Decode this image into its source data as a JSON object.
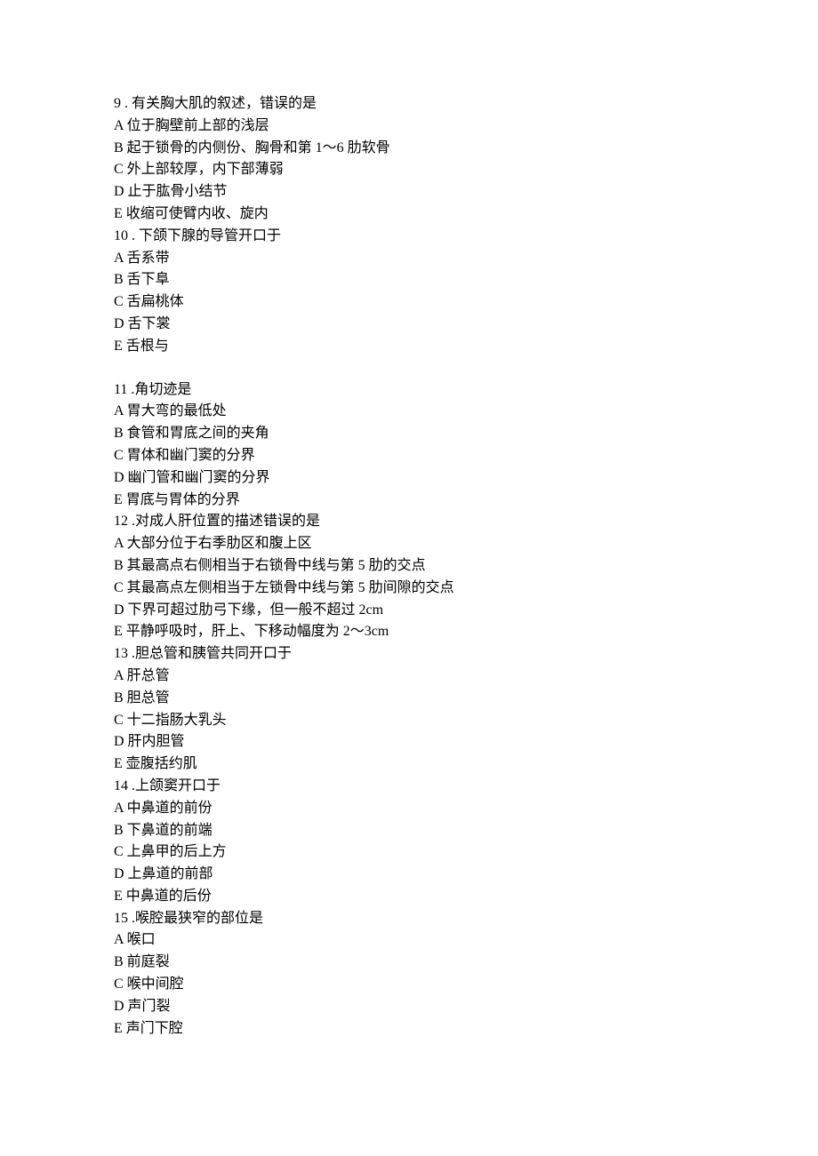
{
  "questions": [
    {
      "num": "9",
      "sep": " . ",
      "stem": "有关胸大肌的叙述，错误的是",
      "options": [
        "A 位于胸壁前上部的浅层",
        "B 起于锁骨的内侧份、胸骨和第 1～6 肋软骨",
        "C 外上部较厚，内下部薄弱",
        "D 止于肱骨小结节",
        "E 收缩可使臂内收、旋内"
      ]
    },
    {
      "num": "10",
      "sep": " . ",
      "stem": "下颌下腺的导管开口于",
      "options": [
        "A 舌系带",
        "B 舌下阜",
        "C 舌扁桃体",
        "D 舌下裳",
        "E 舌根与"
      ]
    },
    {
      "num": "11",
      "sep": " .",
      "stem": "角切迹是",
      "options": [
        "A 胃大弯的最低处",
        "B 食管和胃底之间的夹角",
        "C 胃体和幽门窦的分界",
        "D 幽门管和幽门窦的分界",
        "E 胃底与胃体的分界"
      ]
    },
    {
      "num": "12",
      "sep": " .",
      "stem": "对成人肝位置的描述错误的是",
      "options": [
        "A 大部分位于右季肋区和腹上区",
        "B 其最高点右侧相当于右锁骨中线与第 5 肋的交点",
        "C 其最高点左侧相当于左锁骨中线与第 5 肋间隙的交点",
        "D 下界可超过肋弓下缘，但一般不超过 2cm",
        "E 平静呼吸时，肝上、下移动幅度为 2～3cm"
      ]
    },
    {
      "num": "13",
      "sep": " .",
      "stem": "胆总管和胰管共同开口于",
      "options": [
        "A 肝总管",
        "B 胆总管",
        "C 十二指肠大乳头",
        "D 肝内胆管",
        "E 壶腹括约肌"
      ]
    },
    {
      "num": "14",
      "sep": " .",
      "stem": "上颌窦开口于",
      "options": [
        "A 中鼻道的前份",
        "B 下鼻道的前端",
        "C 上鼻甲的后上方",
        "D 上鼻道的前部",
        "E 中鼻道的后份"
      ]
    },
    {
      "num": "15",
      "sep": " .",
      "stem": "喉腔最狭窄的部位是",
      "options": [
        "A 喉口",
        "B 前庭裂",
        "C 喉中间腔",
        "D 声门裂",
        "E 声门下腔"
      ]
    }
  ]
}
